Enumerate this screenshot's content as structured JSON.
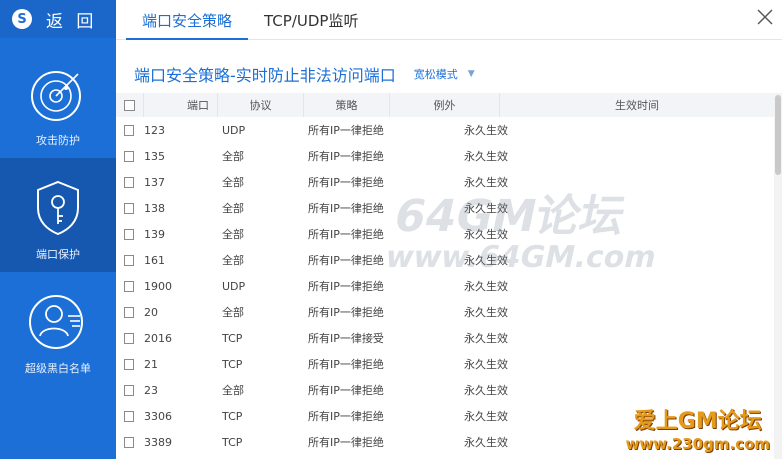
{
  "sidebar": {
    "back_label": "返 回",
    "items": [
      {
        "label": "攻击防护",
        "icon": "radar-icon"
      },
      {
        "label": "端口保护",
        "icon": "key-shield-icon"
      },
      {
        "label": "超级黑白名单",
        "icon": "user-list-icon"
      }
    ]
  },
  "tabs": [
    {
      "label": "端口安全策略",
      "active": true
    },
    {
      "label": "TCP/UDP监听",
      "active": false
    }
  ],
  "page": {
    "title": "端口安全策略-实时防止非法访问端口",
    "mode": "宽松模式"
  },
  "table": {
    "headers": [
      "端口",
      "协议",
      "策略",
      "例外",
      "生效时间"
    ],
    "rows": [
      {
        "port": "123",
        "protocol": "UDP",
        "policy": "所有IP一律拒绝",
        "exception": "",
        "time": "永久生效"
      },
      {
        "port": "135",
        "protocol": "全部",
        "policy": "所有IP一律拒绝",
        "exception": "",
        "time": "永久生效"
      },
      {
        "port": "137",
        "protocol": "全部",
        "policy": "所有IP一律拒绝",
        "exception": "",
        "time": "永久生效"
      },
      {
        "port": "138",
        "protocol": "全部",
        "policy": "所有IP一律拒绝",
        "exception": "",
        "time": "永久生效"
      },
      {
        "port": "139",
        "protocol": "全部",
        "policy": "所有IP一律拒绝",
        "exception": "",
        "time": "永久生效"
      },
      {
        "port": "161",
        "protocol": "全部",
        "policy": "所有IP一律拒绝",
        "exception": "",
        "time": "永久生效"
      },
      {
        "port": "1900",
        "protocol": "UDP",
        "policy": "所有IP一律拒绝",
        "exception": "",
        "time": "永久生效"
      },
      {
        "port": "20",
        "protocol": "全部",
        "policy": "所有IP一律拒绝",
        "exception": "",
        "time": "永久生效"
      },
      {
        "port": "2016",
        "protocol": "TCP",
        "policy": "所有IP一律接受",
        "exception": "",
        "time": "永久生效"
      },
      {
        "port": "21",
        "protocol": "TCP",
        "policy": "所有IP一律拒绝",
        "exception": "",
        "time": "永久生效"
      },
      {
        "port": "23",
        "protocol": "全部",
        "policy": "所有IP一律拒绝",
        "exception": "",
        "time": "永久生效"
      },
      {
        "port": "3306",
        "protocol": "TCP",
        "policy": "所有IP一律拒绝",
        "exception": "",
        "time": "永久生效"
      },
      {
        "port": "3389",
        "protocol": "TCP",
        "policy": "所有IP一律拒绝",
        "exception": "",
        "time": "永久生效"
      }
    ]
  },
  "watermarks": {
    "main": "64GM论坛",
    "url": "www.64GM.com",
    "corner_title": "爱上GM论坛",
    "corner_url": "www.230gm.com"
  },
  "colors": {
    "accent": "#1c6fd6",
    "sidebar_bg": "#1c6fd6",
    "sidebar_active": "#1657b0"
  }
}
